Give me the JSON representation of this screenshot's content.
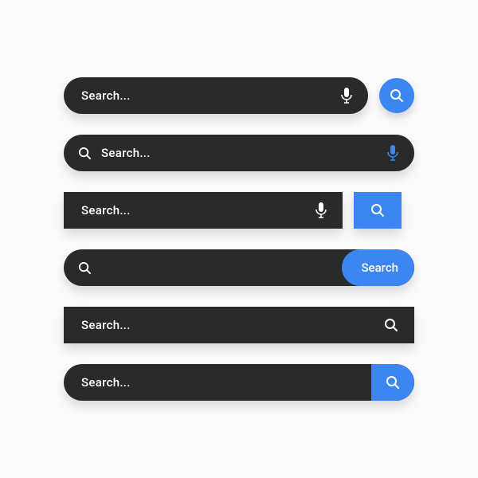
{
  "placeholder": "Search...",
  "button_label": "Search",
  "colors": {
    "bar": "#2a2a2a",
    "accent": "#3b86f0",
    "text": "#ffffff"
  },
  "variants": [
    {
      "id": "v1",
      "shape": "pill",
      "left": null,
      "right": "mic",
      "button": "circle-search"
    },
    {
      "id": "v2",
      "shape": "pill",
      "left": "search",
      "right": "mic-blue",
      "button": null
    },
    {
      "id": "v3",
      "shape": "rect",
      "left": null,
      "right": "mic",
      "button": "rect-search"
    },
    {
      "id": "v4",
      "shape": "pill",
      "left": "search",
      "right": null,
      "button": "pill-text"
    },
    {
      "id": "v5",
      "shape": "rect",
      "left": null,
      "right": "search",
      "button": null
    },
    {
      "id": "v6",
      "shape": "pill",
      "left": null,
      "right": null,
      "button": "rounded-search"
    }
  ]
}
